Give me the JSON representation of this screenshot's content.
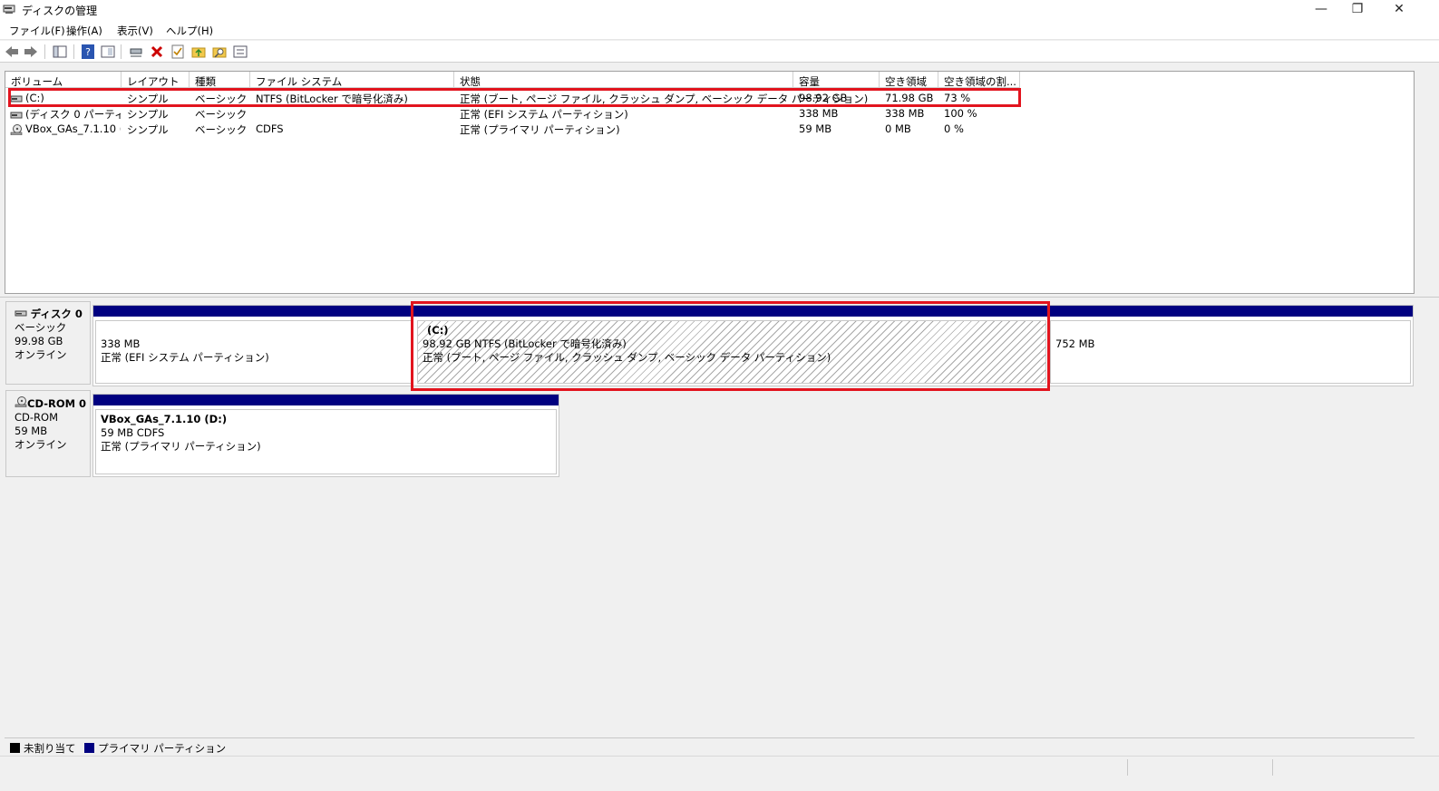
{
  "window": {
    "title": "ディスクの管理",
    "buttons": {
      "minimize": "—",
      "restore": "❐",
      "close": "✕"
    }
  },
  "menu": [
    "ファイル(F)",
    "操作(A)",
    "表示(V)",
    "ヘルプ(H)"
  ],
  "toolbar": {
    "icons": [
      "back-arrow-icon",
      "forward-arrow-icon",
      "show-hide-console-tree-icon",
      "help-icon",
      "properties-icon",
      "connect-icon",
      "delete-icon",
      "check-icon",
      "folder-up-icon",
      "folder-search-icon",
      "options-icon"
    ],
    "delete_color": "#cc0000"
  },
  "volume_list": {
    "columns": [
      "ボリューム",
      "レイアウト",
      "種類",
      "ファイル システム",
      "状態",
      "容量",
      "空き領域",
      "空き領域の割..."
    ],
    "rows": [
      {
        "volume": "(C:)",
        "layout": "シンプル",
        "type": "ベーシック",
        "fs": "NTFS (BitLocker で暗号化済み)",
        "status": "正常 (ブート, ページ ファイル, クラッシュ ダンプ, ベーシック データ パーティション)",
        "capacity": "98.92 GB",
        "free": "71.98 GB",
        "pct": "73 %",
        "icon": "drive-icon"
      },
      {
        "volume": "(ディスク 0 パーティシ...",
        "layout": "シンプル",
        "type": "ベーシック",
        "fs": "",
        "status": "正常 (EFI システム パーティション)",
        "capacity": "338 MB",
        "free": "338 MB",
        "pct": "100 %",
        "icon": "drive-icon"
      },
      {
        "volume": "VBox_GAs_7.1.10 (...",
        "layout": "シンプル",
        "type": "ベーシック",
        "fs": "CDFS",
        "status": "正常 (プライマリ パーティション)",
        "capacity": "59 MB",
        "free": "0 MB",
        "pct": "0 %",
        "icon": "cdrom-icon"
      }
    ]
  },
  "disks": [
    {
      "name": "ディスク 0",
      "type": "ベーシック",
      "size": "99.98 GB",
      "state": "オンライン",
      "partitions": [
        {
          "line1": "338 MB",
          "line2": "正常 (EFI システム パーティション)"
        },
        {
          "title": "(C:)",
          "line1": "98.92 GB NTFS (BitLocker で暗号化済み)",
          "line2": "正常 (ブート, ページ ファイル, クラッシュ ダンプ, ベーシック データ パーティション)"
        },
        {
          "line1": "752 MB"
        }
      ]
    },
    {
      "name": "CD-ROM 0",
      "type": "CD-ROM",
      "size": "59 MB",
      "state": "オンライン",
      "partitions": [
        {
          "title": "VBox_GAs_7.1.10  (D:)",
          "line1": "59 MB CDFS",
          "line2": "正常 (プライマリ パーティション)"
        }
      ]
    }
  ],
  "legend": {
    "unallocated": "未割り当て",
    "primary": "プライマリ パーティション",
    "unallocated_color": "#000000",
    "primary_color": "#000080"
  },
  "highlight_color": "#e2141e"
}
